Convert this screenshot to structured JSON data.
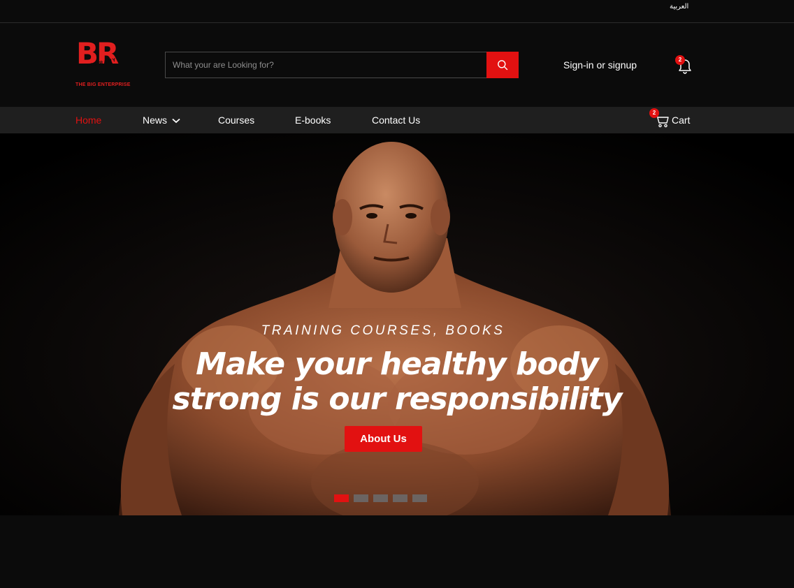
{
  "topbar": {
    "language_label": "العربية"
  },
  "header": {
    "logo": {
      "letters": "BR",
      "small_text": "BIG RAMY",
      "tagline": "THE BIG ENTERPRISE"
    },
    "search": {
      "placeholder": "What your are Looking for?",
      "value": "",
      "button_icon": "search-icon"
    },
    "signin_label": "Sign-in or signup",
    "notifications": {
      "icon": "bell-icon",
      "count": "2"
    }
  },
  "nav": {
    "items": [
      {
        "label": "Home",
        "active": true
      },
      {
        "label": "News",
        "dropdown": true
      },
      {
        "label": "Courses"
      },
      {
        "label": "E-books"
      },
      {
        "label": "Contact Us"
      }
    ],
    "cart": {
      "label": "Cart",
      "count": "2",
      "icon": "cart-icon"
    }
  },
  "hero": {
    "subtitle": "TRAINING COURSES, BOOKS",
    "title_line1": "Make your healthy body",
    "title_line2": "strong is our responsibility",
    "button_label": "About Us",
    "slides_total": 5,
    "active_slide": 1
  },
  "colors": {
    "accent": "#e21111",
    "background": "#0b0b0b",
    "nav_bg": "#1f1f1f"
  }
}
